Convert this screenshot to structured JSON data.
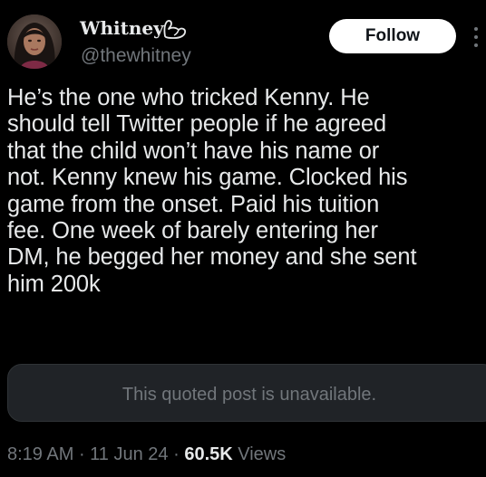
{
  "author": {
    "display_name": "Whitney",
    "handle": "@thewhitney",
    "avatar_icon": "profile-photo",
    "name_emoji_icon": "flexed-biceps-icon"
  },
  "actions": {
    "follow_label": "Follow",
    "more_icon": "vertical-ellipsis-icon"
  },
  "tweet": {
    "text": "He’s the one who tricked Kenny.  He\nshould tell Twitter people if he agreed\nthat the child won’t have his name or\nnot. Kenny knew his game.  Clocked his\ngame from the onset. Paid his tuition\nfee.  One week of barely entering her\nDM, he begged her money and she sent\nhim 200k"
  },
  "quote": {
    "text": "This quoted post is unavailable."
  },
  "meta": {
    "time": "8:19 AM",
    "separator": " · ",
    "date": "11 Jun 24",
    "views_count": "60.5K",
    "views_label": " Views"
  },
  "colors": {
    "background": "#000000",
    "primary_text": "#e7e9ea",
    "secondary_text": "#71767b",
    "follow_bg": "#ffffff",
    "quote_bg": "#202327"
  }
}
